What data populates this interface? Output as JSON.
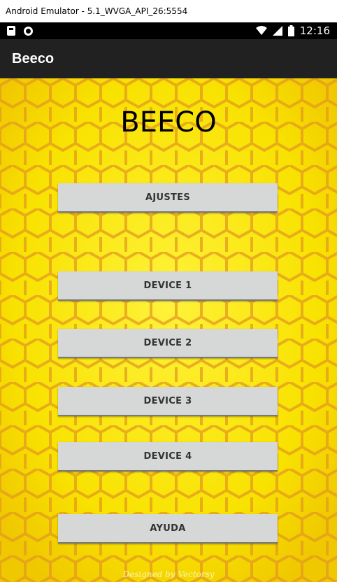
{
  "window": {
    "title": "Android Emulator - 5.1_WVGA_API_26:5554"
  },
  "status_bar": {
    "time": "12:16",
    "icons": [
      "sd-card-icon",
      "circle-icon",
      "wifi-icon",
      "signal-icon",
      "battery-icon"
    ]
  },
  "app_bar": {
    "title": "Beeco"
  },
  "main": {
    "heading": "BEECO",
    "buttons": {
      "settings": "AJUSTES",
      "device1": "DEVICE 1",
      "device2": "DEVICE 2",
      "device3": "DEVICE 3",
      "device4": "DEVICE 4",
      "help": "AYUDA"
    },
    "watermark": "Designed by Vectorsy"
  },
  "colors": {
    "background_yellow": "#f7e600",
    "honeycomb_orange": "#e8a020",
    "app_bar": "#212121",
    "button": "#d6d7d7"
  }
}
